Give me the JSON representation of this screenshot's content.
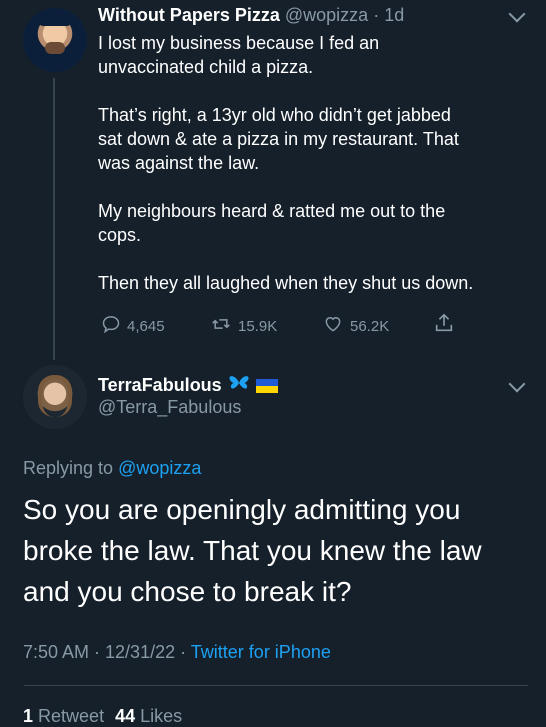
{
  "tweet1": {
    "display_name": "Without Papers Pizza",
    "handle": "@wopizza",
    "time_sep": "·",
    "time": "1d",
    "text": "I lost my business because I fed an\nunvaccinated child a pizza.\n\nThat’s right, a 13yr old who didn’t get jabbed\nsat down & ate a pizza in my restaurant. That\nwas against the law.\n\nMy neighbours heard & ratted me out to the\ncops.\n\nThen they all laughed when they shut us down.",
    "replies": "4,645",
    "retweets": "15.9K",
    "likes": "56.2K"
  },
  "tweet2": {
    "display_name": "TerraFabulous",
    "handle": "@Terra_Fabulous",
    "replying_to_prefix": "Replying to",
    "replying_to_handle": "@wopizza",
    "text": "So you are openingly admitting you\nbroke the law. That you knew the law\nand you chose to break it?",
    "timestamp": "7:50 AM · 12/31/22 ·",
    "client": "Twitter for iPhone",
    "retweet_count": "1",
    "retweet_label": "Retweet",
    "like_count": "44",
    "like_label": "Likes"
  },
  "icons": [
    "reply-icon",
    "retweet-icon",
    "like-icon",
    "share-icon",
    "chevron-down-icon",
    "butterfly-icon",
    "ukraine-flag-icon"
  ],
  "colors": {
    "background": "#15202b",
    "muted": "#8899a6",
    "link": "#1da1f2",
    "butterfly": "#1da1f2",
    "flag_blue": "#1f5bd7",
    "flag_yellow": "#ffd500"
  }
}
